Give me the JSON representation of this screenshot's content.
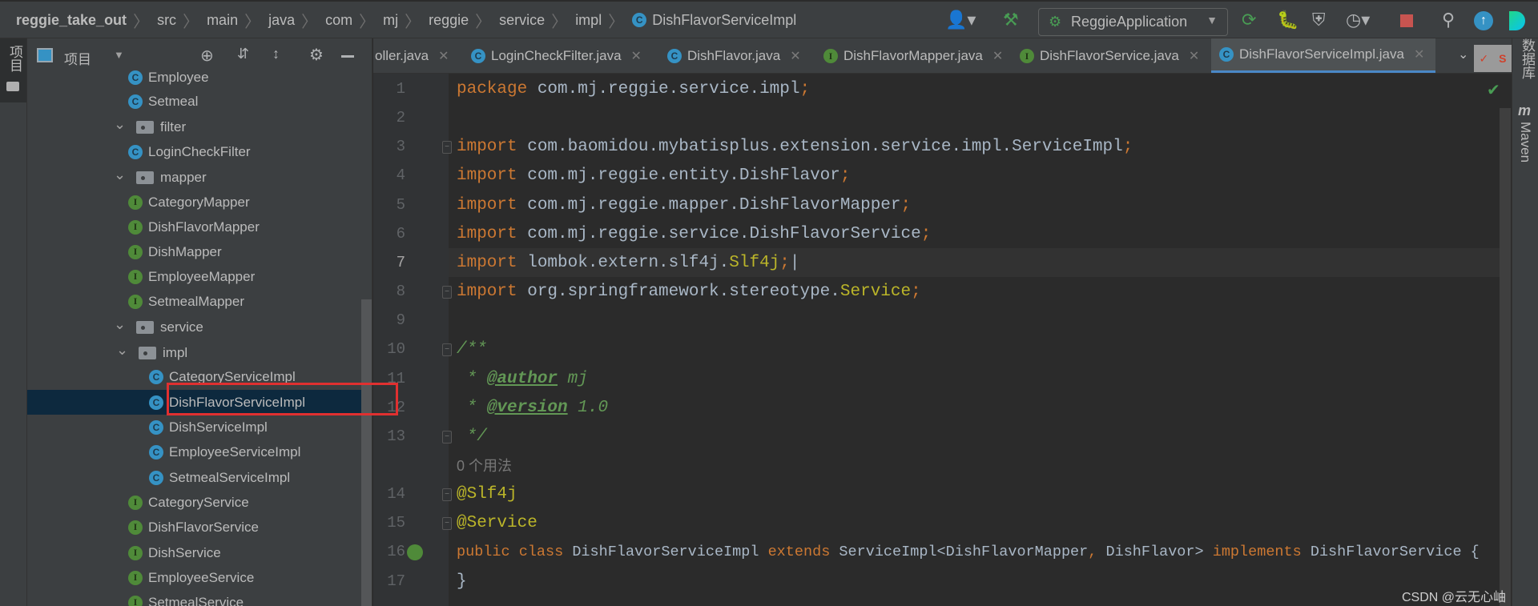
{
  "breadcrumb": [
    "reggie_take_out",
    "src",
    "main",
    "java",
    "com",
    "mj",
    "reggie",
    "service",
    "impl",
    "DishFlavorServiceImpl"
  ],
  "toolbar": {
    "run_config": "ReggieApplication"
  },
  "left_strip": {
    "project_label": "项目"
  },
  "panel": {
    "title": "项目"
  },
  "tree": [
    {
      "label": "Employee",
      "type": "class",
      "depth": 2
    },
    {
      "label": "Setmeal",
      "type": "class",
      "depth": 2
    },
    {
      "label": "filter",
      "type": "folder",
      "depth": 1
    },
    {
      "label": "LoginCheckFilter",
      "type": "class",
      "depth": 2
    },
    {
      "label": "mapper",
      "type": "folder",
      "depth": 1
    },
    {
      "label": "CategoryMapper",
      "type": "interface",
      "depth": 2
    },
    {
      "label": "DishFlavorMapper",
      "type": "interface",
      "depth": 2
    },
    {
      "label": "DishMapper",
      "type": "interface",
      "depth": 2
    },
    {
      "label": "EmployeeMapper",
      "type": "interface",
      "depth": 2
    },
    {
      "label": "SetmealMapper",
      "type": "interface",
      "depth": 2
    },
    {
      "label": "service",
      "type": "folder",
      "depth": 1
    },
    {
      "label": "impl",
      "type": "folder",
      "depth": 2
    },
    {
      "label": "CategoryServiceImpl",
      "type": "class",
      "depth": 3
    },
    {
      "label": "DishFlavorServiceImpl",
      "type": "class",
      "depth": 3,
      "selected": true
    },
    {
      "label": "DishServiceImpl",
      "type": "class",
      "depth": 3
    },
    {
      "label": "EmployeeServiceImpl",
      "type": "class",
      "depth": 3
    },
    {
      "label": "SetmealServiceImpl",
      "type": "class",
      "depth": 3
    },
    {
      "label": "CategoryService",
      "type": "interface",
      "depth": 2
    },
    {
      "label": "DishFlavorService",
      "type": "interface",
      "depth": 2
    },
    {
      "label": "DishService",
      "type": "interface",
      "depth": 2
    },
    {
      "label": "EmployeeService",
      "type": "interface",
      "depth": 2
    },
    {
      "label": "SetmealService",
      "type": "interface",
      "depth": 2
    }
  ],
  "tabs": [
    {
      "label": "oller.java",
      "icon": "class"
    },
    {
      "label": "LoginCheckFilter.java",
      "icon": "class"
    },
    {
      "label": "DishFlavor.java",
      "icon": "class"
    },
    {
      "label": "DishFlavorMapper.java",
      "icon": "interface"
    },
    {
      "label": "DishFlavorService.java",
      "icon": "interface"
    },
    {
      "label": "DishFlavorServiceImpl.java",
      "icon": "class",
      "active": true
    }
  ],
  "code": [
    {
      "n": "1",
      "tokens": [
        [
          "kw",
          "package "
        ],
        [
          "tx",
          "com.mj.reggie.service.impl"
        ],
        [
          "kw",
          ";"
        ]
      ]
    },
    {
      "n": "2",
      "tokens": []
    },
    {
      "n": "3",
      "fold": true,
      "tokens": [
        [
          "kw",
          "import "
        ],
        [
          "tx",
          "com.baomidou.mybatisplus.extension.service.impl.ServiceImpl"
        ],
        [
          "kw",
          ";"
        ]
      ]
    },
    {
      "n": "4",
      "tokens": [
        [
          "kw",
          "import "
        ],
        [
          "tx",
          "com.mj.reggie.entity.DishFlavor"
        ],
        [
          "kw",
          ";"
        ]
      ]
    },
    {
      "n": "5",
      "tokens": [
        [
          "kw",
          "import "
        ],
        [
          "tx",
          "com.mj.reggie.mapper.DishFlavorMapper"
        ],
        [
          "kw",
          ";"
        ]
      ]
    },
    {
      "n": "6",
      "tokens": [
        [
          "kw",
          "import "
        ],
        [
          "tx",
          "com.mj.reggie.service.DishFlavorService"
        ],
        [
          "kw",
          ";"
        ]
      ]
    },
    {
      "n": "7",
      "current": true,
      "tokens": [
        [
          "kw",
          "import "
        ],
        [
          "tx",
          "lombok.extern.slf4j."
        ],
        [
          "an",
          "Slf4j"
        ],
        [
          "kw",
          ";"
        ],
        [
          "tx",
          "|"
        ]
      ]
    },
    {
      "n": "8",
      "fold": true,
      "tokens": [
        [
          "kw",
          "import "
        ],
        [
          "tx",
          "org.springframework.stereotype."
        ],
        [
          "an",
          "Service"
        ],
        [
          "kw",
          ";"
        ]
      ]
    },
    {
      "n": "9",
      "tokens": []
    },
    {
      "n": "10",
      "fold": true,
      "tokens": [
        [
          "dc",
          "/**"
        ]
      ]
    },
    {
      "n": "11",
      "tokens": [
        [
          "dc",
          " * "
        ],
        [
          "dt",
          "@author"
        ],
        [
          "dc",
          " mj"
        ]
      ]
    },
    {
      "n": "12",
      "tokens": [
        [
          "dc",
          " * "
        ],
        [
          "dt",
          "@version"
        ],
        [
          "dc",
          " 1.0"
        ]
      ]
    },
    {
      "n": "13",
      "fold": true,
      "tokens": [
        [
          "dc",
          " */"
        ]
      ]
    },
    {
      "n": "",
      "tokens": [
        [
          "hint",
          "0 个用法"
        ]
      ]
    },
    {
      "n": "14",
      "fold": true,
      "tokens": [
        [
          "an",
          "@Slf4j"
        ]
      ]
    },
    {
      "n": "15",
      "fold": true,
      "tokens": [
        [
          "an",
          "@Service"
        ]
      ]
    },
    {
      "n": "16",
      "gutter_icon": "spring-bean",
      "tokens": [
        [
          "kw",
          "public class "
        ],
        [
          "tx",
          "DishFlavorServiceImpl "
        ],
        [
          "kw",
          "extends "
        ],
        [
          "tx",
          "ServiceImpl<DishFlavorMapper"
        ],
        [
          "kw",
          ", "
        ],
        [
          "tx",
          "DishFlavor> "
        ],
        [
          "kw",
          "implements "
        ],
        [
          "tx",
          "DishFlavorService {"
        ]
      ]
    },
    {
      "n": "17",
      "tokens": [
        [
          "tx",
          "}"
        ]
      ]
    }
  ],
  "right_strip": {
    "database_label": "数据库",
    "maven_label": "Maven"
  },
  "watermark": "CSDN @云无心岫",
  "colors": {
    "keyword": "#cc7832",
    "text": "#a9b7c6",
    "annotation": "#bbb529",
    "doc_comment": "#629755",
    "selection": "#0d293e",
    "accent": "#4a88c7",
    "highlight_box": "#e03030"
  }
}
